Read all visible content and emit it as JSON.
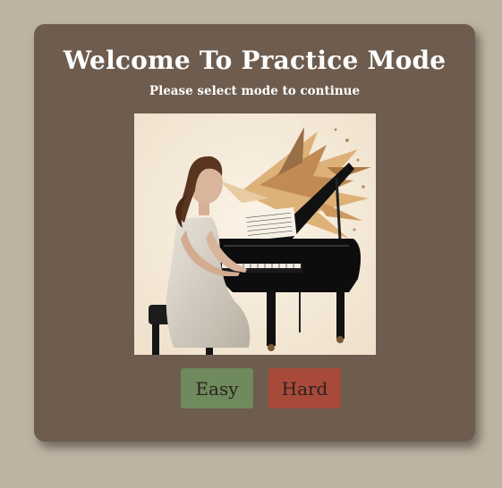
{
  "page": {
    "title": "Welcome To Practice Mode",
    "subtitle": "Please select mode to continue"
  },
  "illustration": {
    "alt": "woman-playing-grand-piano"
  },
  "buttons": {
    "easy_label": "Easy",
    "hard_label": "Hard"
  },
  "colors": {
    "background": "#bcb3a3",
    "card": "#6e5c4e",
    "easy": "#6f8a5c",
    "hard": "#a84a3a"
  }
}
